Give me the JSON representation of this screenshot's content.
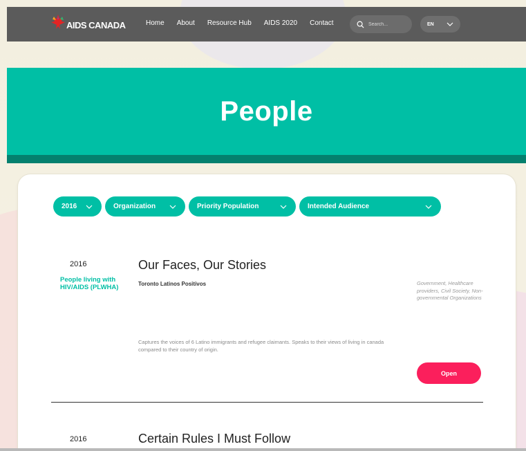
{
  "brand": {
    "logo_text": "AIDS CANADA"
  },
  "nav": {
    "items": [
      "Home",
      "About",
      "Resource Hub",
      "AIDS 2020",
      "Contact"
    ]
  },
  "search": {
    "placeholder": "Search..."
  },
  "language": {
    "selected": "EN"
  },
  "hero": {
    "title": "People"
  },
  "filters": {
    "year": "2016",
    "organization": "Organization",
    "priority_population": "Priority Population",
    "intended_audience": "Intended Audience"
  },
  "entries": [
    {
      "year": "2016",
      "population": "People living with HIV/AIDS (PLWHA)",
      "title": "Our Faces, Our Stories",
      "organization": "Toronto Latinos Positivos",
      "audience": "Government, Healthcare providers, Civil Society, Non-governmental Organizations",
      "description": "Captures the voices of 6 Latino immigrants and refugee claimants. Speaks to their views of living in canada compared to their country of origin.",
      "button": "Open"
    },
    {
      "year": "2016",
      "title": "Certain Rules I Must Follow"
    }
  ],
  "colors": {
    "header_bg": "#5b5b5b",
    "accent_teal": "#00bfa5",
    "accent_dark_teal": "#04806e",
    "open_button": "#fb1f5c",
    "page_bg": "#f5f2e0"
  }
}
